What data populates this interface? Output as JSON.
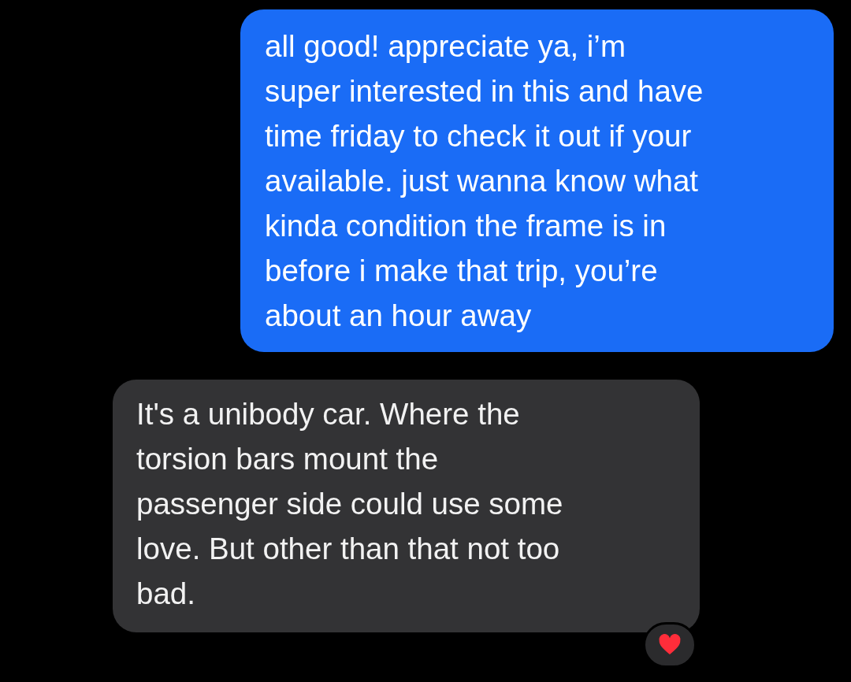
{
  "messages": [
    {
      "kind": "sent",
      "text": "all good! appreciate ya, i’m\nsuper interested in this and have\ntime friday to check it out if your\navailable. just wanna know what\nkinda condition the frame is in\nbefore i make that trip, you’re\nabout an hour away"
    },
    {
      "kind": "received",
      "text": "It's a unibody car. Where the\ntorsion bars mount the\npassenger side could use some\nlove. But other than that not too\nbad.",
      "reaction": {
        "kind": "heart"
      }
    }
  ]
}
